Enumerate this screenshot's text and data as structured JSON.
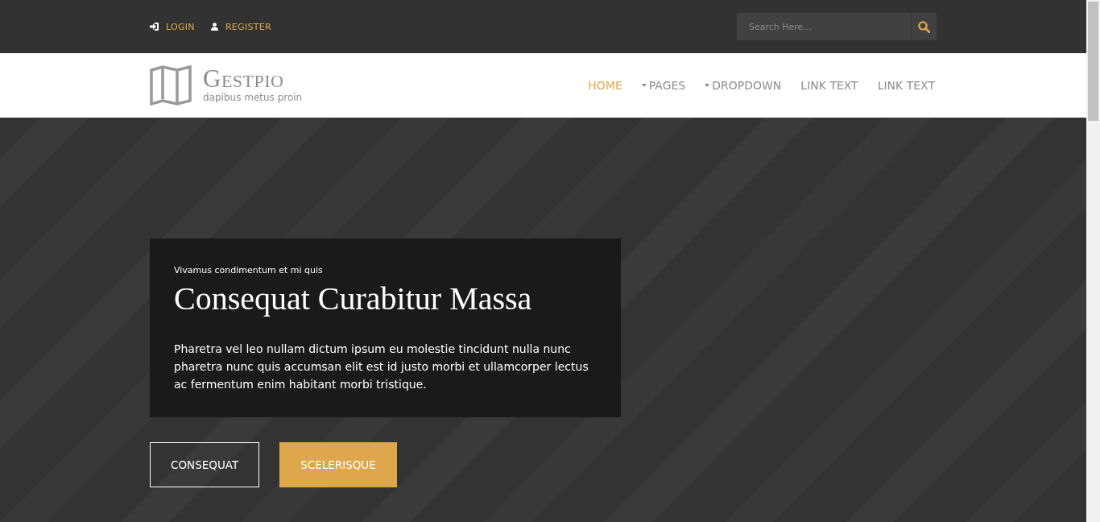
{
  "top_bar": {
    "links": [
      {
        "label": "LOGIN",
        "kind": "login"
      },
      {
        "label": "REGISTER",
        "kind": "user"
      }
    ],
    "search": {
      "placeholder": "Search Here..."
    }
  },
  "nav": {
    "logo": {
      "name": "GESTPIO",
      "tagline": "dapibus metus proin"
    },
    "items": [
      {
        "label": "HOME",
        "selected": true,
        "dropdown": false
      },
      {
        "label": "PAGES",
        "selected": false,
        "dropdown": true
      },
      {
        "label": "DROPDOWN",
        "selected": false,
        "dropdown": true
      },
      {
        "label": "LINK TEXT",
        "selected": false,
        "dropdown": false
      },
      {
        "label": "LINK TEXT",
        "selected": false,
        "dropdown": false
      }
    ]
  },
  "hero": {
    "kind": "picture",
    "kicker": "Vivamus condimentum et mi quis",
    "title": "Consequat Curabitur Massa",
    "text": "Pharetra vel leo nullam dictum ipsum eu molestie tincidunt nulla nunc pharetra nunc quis accumsan elit est id justo morbi et ullamcorper lectus ac fermentum enim habitant morbi tristique.",
    "buttons": [
      {
        "label": "CONSEQUAT",
        "kind": "outline"
      },
      {
        "label": "SCELERISQUE",
        "kind": "filled"
      }
    ]
  }
}
